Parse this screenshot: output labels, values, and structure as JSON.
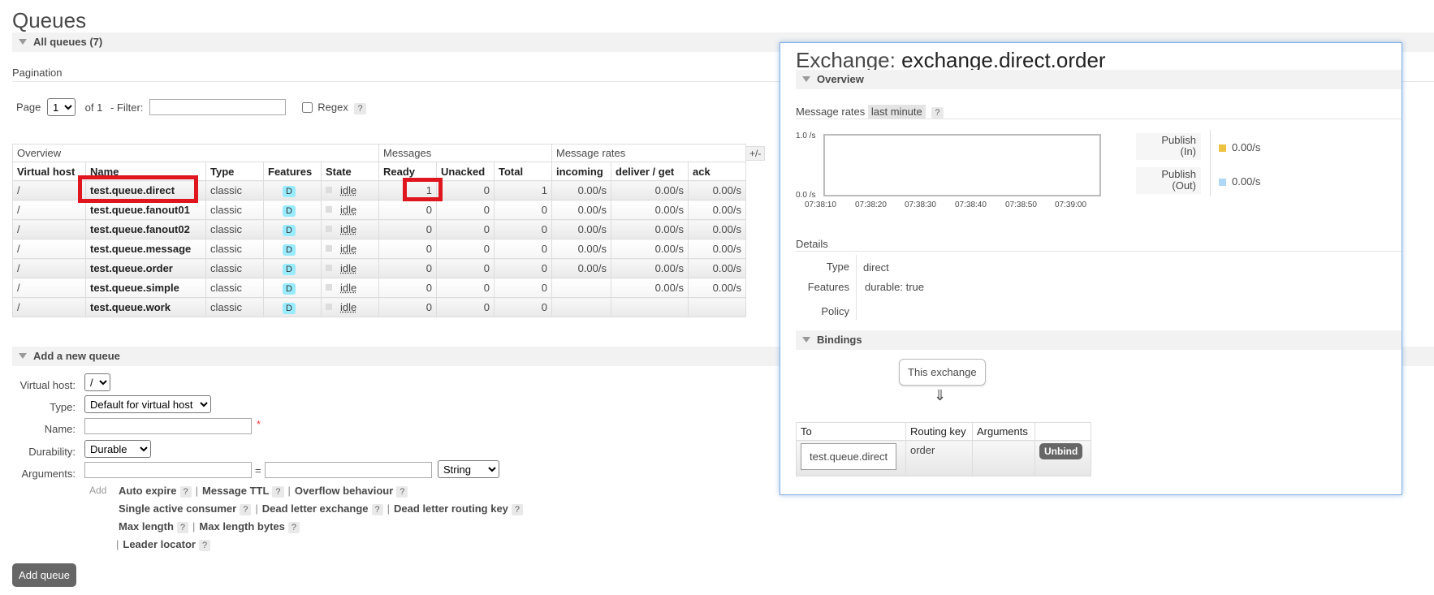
{
  "page": {
    "title": "Queues",
    "all_queues": "All queues (7)",
    "pagination_label": "Pagination"
  },
  "pagination": {
    "page_label": "Page",
    "page_value": "1",
    "of_label": "of 1",
    "filter_label": "- Filter:",
    "filter_value": "",
    "regex_label": "Regex",
    "help": "?"
  },
  "table": {
    "groups": [
      "Overview",
      "Messages",
      "Message rates"
    ],
    "headers": [
      "Virtual host",
      "Name",
      "Type",
      "Features",
      "State",
      "Ready",
      "Unacked",
      "Total",
      "incoming",
      "deliver / get",
      "ack"
    ],
    "plus_minus": "+/-",
    "rows": [
      {
        "vhost": "/",
        "name": "test.queue.direct",
        "type": "classic",
        "feature": "D",
        "state": "idle",
        "ready": "1",
        "unacked": "0",
        "total": "1",
        "incoming": "0.00/s",
        "deliver": "0.00/s",
        "ack": "0.00/s"
      },
      {
        "vhost": "/",
        "name": "test.queue.fanout01",
        "type": "classic",
        "feature": "D",
        "state": "idle",
        "ready": "0",
        "unacked": "0",
        "total": "0",
        "incoming": "0.00/s",
        "deliver": "0.00/s",
        "ack": "0.00/s"
      },
      {
        "vhost": "/",
        "name": "test.queue.fanout02",
        "type": "classic",
        "feature": "D",
        "state": "idle",
        "ready": "0",
        "unacked": "0",
        "total": "0",
        "incoming": "0.00/s",
        "deliver": "0.00/s",
        "ack": "0.00/s"
      },
      {
        "vhost": "/",
        "name": "test.queue.message",
        "type": "classic",
        "feature": "D",
        "state": "idle",
        "ready": "0",
        "unacked": "0",
        "total": "0",
        "incoming": "0.00/s",
        "deliver": "0.00/s",
        "ack": "0.00/s"
      },
      {
        "vhost": "/",
        "name": "test.queue.order",
        "type": "classic",
        "feature": "D",
        "state": "idle",
        "ready": "0",
        "unacked": "0",
        "total": "0",
        "incoming": "0.00/s",
        "deliver": "0.00/s",
        "ack": "0.00/s"
      },
      {
        "vhost": "/",
        "name": "test.queue.simple",
        "type": "classic",
        "feature": "D",
        "state": "idle",
        "ready": "0",
        "unacked": "0",
        "total": "0",
        "incoming": "",
        "deliver": "0.00/s",
        "ack": "0.00/s"
      },
      {
        "vhost": "/",
        "name": "test.queue.work",
        "type": "classic",
        "feature": "D",
        "state": "idle",
        "ready": "0",
        "unacked": "0",
        "total": "0",
        "incoming": "",
        "deliver": "",
        "ack": ""
      }
    ]
  },
  "add_queue": {
    "section_title": "Add a new queue",
    "vhost_label": "Virtual host:",
    "vhost_value": "/",
    "type_label": "Type:",
    "type_value": "Default for virtual host",
    "name_label": "Name:",
    "name_value": "",
    "required_mark": "*",
    "durability_label": "Durability:",
    "durability_value": "Durable",
    "arguments_label": "Arguments:",
    "equals": "=",
    "arg_type_value": "String",
    "add_label": "Add",
    "options": [
      "Auto expire",
      "Message TTL",
      "Overflow behaviour",
      "Single active consumer",
      "Dead letter exchange",
      "Dead letter routing key",
      "Max length",
      "Max length bytes",
      "Leader locator"
    ],
    "separator": "|",
    "help": "?",
    "button": "Add queue"
  },
  "exchange": {
    "title_prefix": "Exchange:",
    "title_name": "exchange.direct.order",
    "overview": "Overview",
    "rates_label": "Message rates",
    "rates_period": "last minute",
    "help": "?",
    "y_top": "1.0 /s",
    "y_bottom": "0.0 /s",
    "x_ticks": [
      "07:38:10",
      "07:38:20",
      "07:38:30",
      "07:38:40",
      "07:38:50",
      "07:39:00"
    ],
    "legend": [
      {
        "label1": "Publish",
        "label2": "(In)",
        "value": "0.00/s",
        "color": "#edc240"
      },
      {
        "label1": "Publish",
        "label2": "(Out)",
        "value": "0.00/s",
        "color": "#afd8f8"
      }
    ],
    "details_label": "Details",
    "type_label": "Type",
    "type_value": "direct",
    "features_label": "Features",
    "durable_label": "durable:",
    "durable_value": "true",
    "policy_label": "Policy",
    "bindings": "Bindings",
    "this_exchange": "This exchange",
    "arrow": "⇓",
    "bind_headers": [
      "To",
      "Routing key",
      "Arguments",
      ""
    ],
    "binding": {
      "to": "test.queue.direct",
      "routing_key": "order",
      "arguments": ""
    },
    "unbind": "Unbind"
  }
}
